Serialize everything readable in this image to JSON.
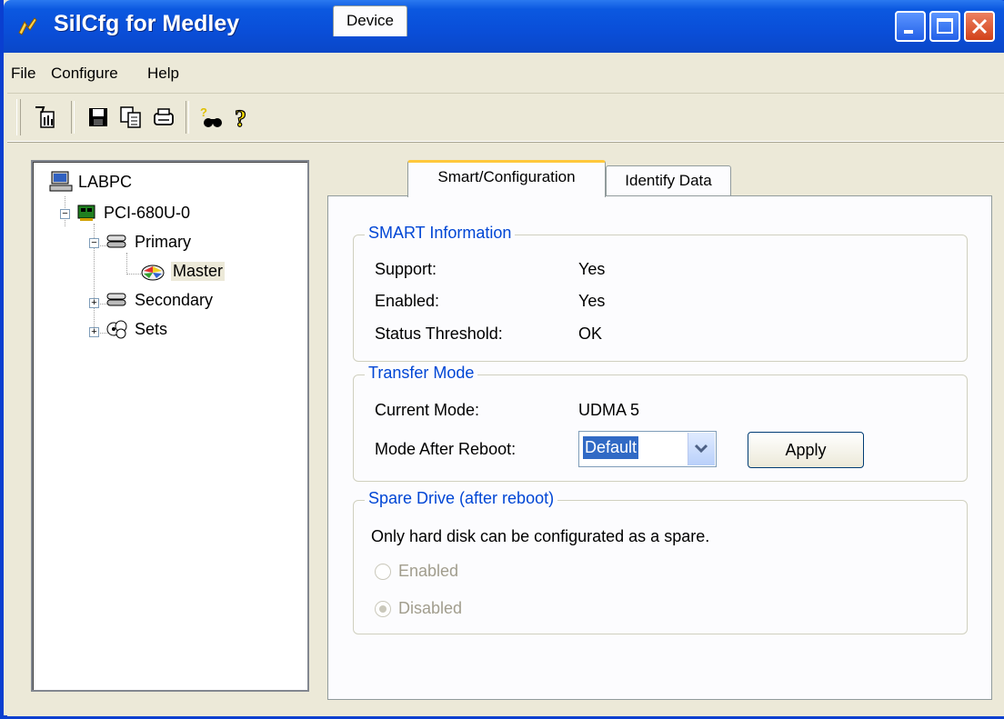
{
  "window": {
    "title": "SilCfg for Medley"
  },
  "menu": {
    "file": "File",
    "configure": "Configure",
    "help": "Help"
  },
  "toolbar": {
    "icons": [
      "connect-icon",
      "save-icon",
      "copy-icon",
      "print-icon",
      "find-help-icon",
      "help-icon"
    ]
  },
  "tree": {
    "root": "LABPC",
    "controller": "PCI-680U-0",
    "primary": "Primary",
    "master": "Master",
    "secondary": "Secondary",
    "sets": "Sets"
  },
  "tabs": {
    "device": "Device",
    "smart": "Smart/Configuration",
    "identify": "Identify Data",
    "active": "Smart/Configuration"
  },
  "smart": {
    "title": "SMART Information",
    "support_label": "Support:",
    "support_value": "Yes",
    "enabled_label": "Enabled:",
    "enabled_value": "Yes",
    "threshold_label": "Status Threshold:",
    "threshold_value": "OK"
  },
  "transfer": {
    "title": "Transfer Mode",
    "current_label": "Current Mode:",
    "current_value": "UDMA 5",
    "after_label": "Mode After Reboot:",
    "after_value": "Default",
    "apply": "Apply"
  },
  "spare": {
    "title": "Spare Drive (after reboot)",
    "note": "Only hard disk can be configurated as a spare.",
    "enabled": "Enabled",
    "disabled": "Disabled",
    "selected": "Disabled"
  },
  "colors": {
    "titlebar": "#0a4ed8",
    "group_title": "#0046d5",
    "selection": "#316ac5",
    "tab_highlight": "#ffc83c"
  }
}
